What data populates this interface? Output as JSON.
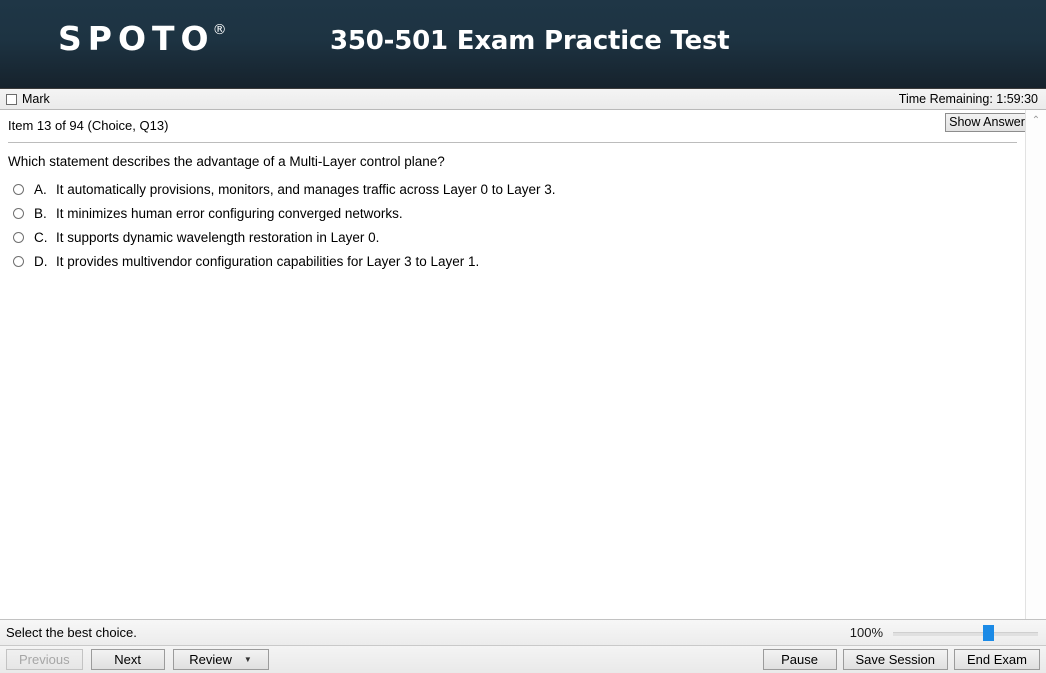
{
  "header": {
    "logo_text": "SPOTO",
    "logo_trademark": "®",
    "exam_title": "350-501 Exam Practice Test"
  },
  "markbar": {
    "mark_label": "Mark",
    "timer_text": "Time Remaining: 1:59:30"
  },
  "item": {
    "item_label": "Item 13 of 94  (Choice, Q13)",
    "show_answer_label": "Show Answer",
    "question_text": "Which statement describes the advantage of a Multi-Layer control plane?",
    "choices": [
      {
        "letter": "A.",
        "text": "It automatically provisions, monitors, and manages traffic across Layer 0 to Layer 3."
      },
      {
        "letter": "B.",
        "text": "It minimizes human error configuring converged networks."
      },
      {
        "letter": "C.",
        "text": "It supports dynamic wavelength restoration in Layer 0."
      },
      {
        "letter": "D.",
        "text": "It provides multivendor configuration capabilities for Layer 3 to Layer 1."
      }
    ]
  },
  "scrollbar": {
    "up_arrow": "⌃"
  },
  "statusbar": {
    "hint_text": "Select the best choice.",
    "zoom_percent": "100%"
  },
  "buttons": {
    "previous": "Previous",
    "next": "Next",
    "review": "Review",
    "review_caret": "▼",
    "pause": "Pause",
    "save_session": "Save Session",
    "end_exam": "End Exam"
  },
  "colors": {
    "header_bg": "#1d3342",
    "slider_thumb": "#1b8ae6",
    "panel_bg": "#ececec"
  }
}
